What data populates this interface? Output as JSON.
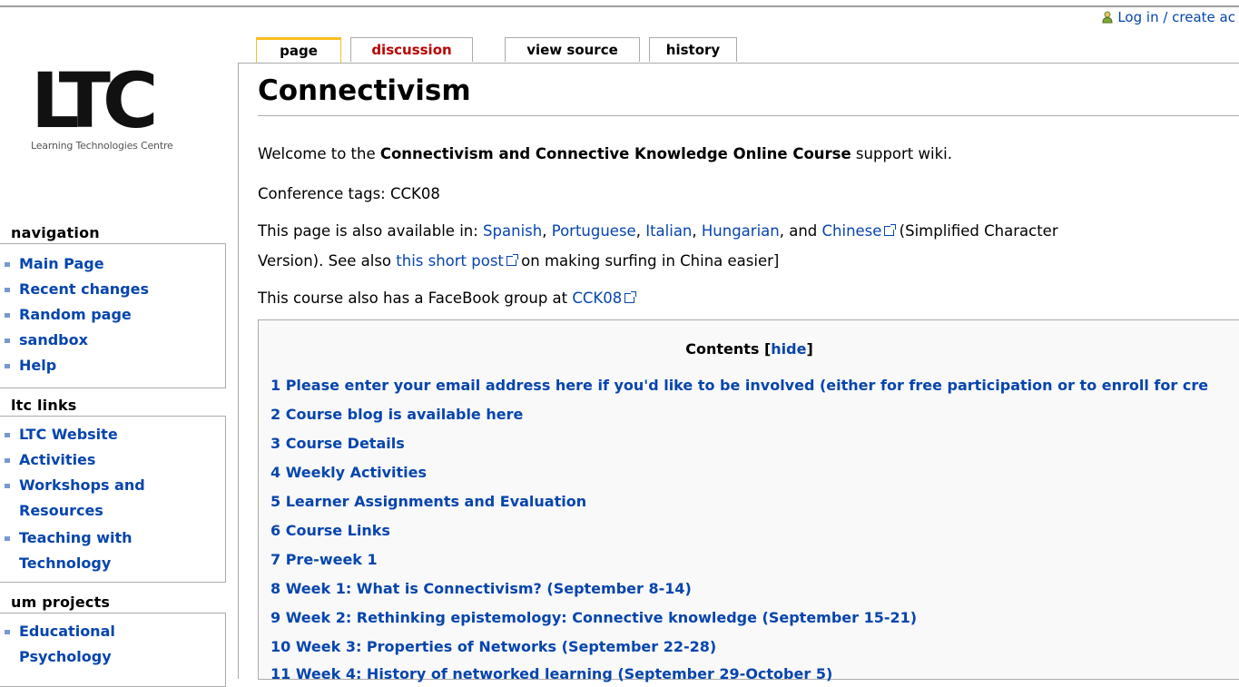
{
  "personal_tools": {
    "login_label": "Log in / create ac"
  },
  "logo": {
    "wordmark": "LTC",
    "subtitle": "Learning Technologies Centre"
  },
  "tabs": [
    {
      "label": "page",
      "state": "selected"
    },
    {
      "label": "discussion",
      "state": "missing"
    },
    {
      "label": "view source",
      "state": "normal"
    },
    {
      "label": "history",
      "state": "normal"
    }
  ],
  "page": {
    "title": "Connectivism",
    "welcome": {
      "before": "Welcome to the ",
      "bold": "Connectivism and Connective Knowledge Online Course",
      "after": " support wiki."
    },
    "tags": "Conference tags: CCK08",
    "languages": {
      "prefix": "This page is also available in: ",
      "spanish": "Spanish",
      "sep1": ", ",
      "portuguese": "Portuguese",
      "sep2": ", ",
      "italian": "Italian",
      "sep3": ", ",
      "hungarian": "Hungarian",
      "sep4": ", and ",
      "chinese": "Chinese",
      "suffix1": " (Simplified Character",
      "line2_prefix": "Version). See also ",
      "short_post": "this short post",
      "line2_suffix": " on making surfing in China easier]"
    },
    "facebook": {
      "prefix": "This course also has a FaceBook group at ",
      "link": "CCK08"
    }
  },
  "toc": {
    "title": "Contents",
    "bracket_open": " [",
    "hide_label": "hide",
    "bracket_close": "]",
    "items": [
      "1 Please enter your email address here if you'd like to be involved (either for free participation or to enroll for cre",
      "2 Course blog is available here",
      "3 Course Details",
      "4 Weekly Activities",
      "5 Learner Assignments and Evaluation",
      "6 Course Links",
      "7 Pre-week 1",
      "8 Week 1: What is Connectivism? (September 8-14)",
      "9 Week 2: Rethinking epistemology: Connective knowledge (September 15-21)",
      "10 Week 3: Properties of Networks (September 22-28)",
      "11 Week 4: History of networked learning (September 29-October 5)"
    ]
  },
  "sidebar": {
    "navigation": {
      "heading": "navigation",
      "items": [
        "Main Page",
        "Recent changes",
        "Random page",
        "sandbox",
        "Help"
      ]
    },
    "ltc_links": {
      "heading": "ltc links",
      "items": [
        "LTC Website",
        "Activities",
        "Workshops and",
        "Resources",
        "Teaching with",
        "Technology"
      ]
    },
    "um_projects": {
      "heading": "um projects",
      "items": [
        "Educational",
        "Psychology"
      ]
    }
  },
  "colors": {
    "link": "#0645ad",
    "missing_link": "#ba0000",
    "selected_tab": "#fabd23"
  },
  "icons": {
    "login": "user-icon",
    "external": "external-link-icon"
  }
}
